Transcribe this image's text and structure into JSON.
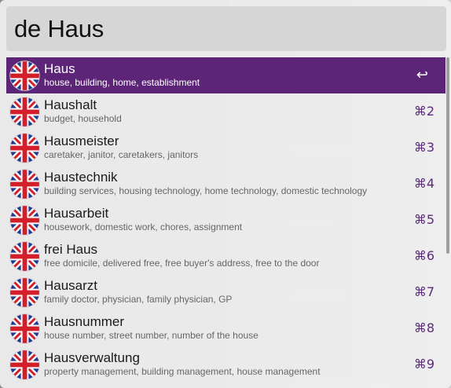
{
  "search": {
    "query": "de Haus"
  },
  "results": [
    {
      "title": "Haus",
      "subtitle": "house, building, home, establishment",
      "shortcut": "↩",
      "icon": "uk-flag-icon",
      "selected": true
    },
    {
      "title": "Haushalt",
      "subtitle": "budget, household",
      "shortcut": "⌘2",
      "icon": "uk-flag-icon"
    },
    {
      "title": "Hausmeister",
      "subtitle": "caretaker, janitor, caretakers, janitors",
      "shortcut": "⌘3",
      "icon": "uk-flag-icon"
    },
    {
      "title": "Haustechnik",
      "subtitle": "building services, housing technology, home technology, domestic technology",
      "shortcut": "⌘4",
      "icon": "uk-flag-icon"
    },
    {
      "title": "Hausarbeit",
      "subtitle": "housework, domestic work, chores, assignment",
      "shortcut": "⌘5",
      "icon": "uk-flag-icon"
    },
    {
      "title": "frei Haus",
      "subtitle": "free domicile, delivered free, free buyer's address, free to the door",
      "shortcut": "⌘6",
      "icon": "uk-flag-icon"
    },
    {
      "title": "Hausarzt",
      "subtitle": "family doctor, physician, family physician, GP",
      "shortcut": "⌘7",
      "icon": "uk-flag-icon"
    },
    {
      "title": "Hausnummer",
      "subtitle": "house number, street number, number of the house",
      "shortcut": "⌘8",
      "icon": "uk-flag-icon"
    },
    {
      "title": "Hausverwaltung",
      "subtitle": "property management, building management, house management",
      "shortcut": "⌘9",
      "icon": "uk-flag-icon"
    }
  ],
  "colors": {
    "selection": "#5d2577",
    "shortcut": "#5b2a7a"
  }
}
